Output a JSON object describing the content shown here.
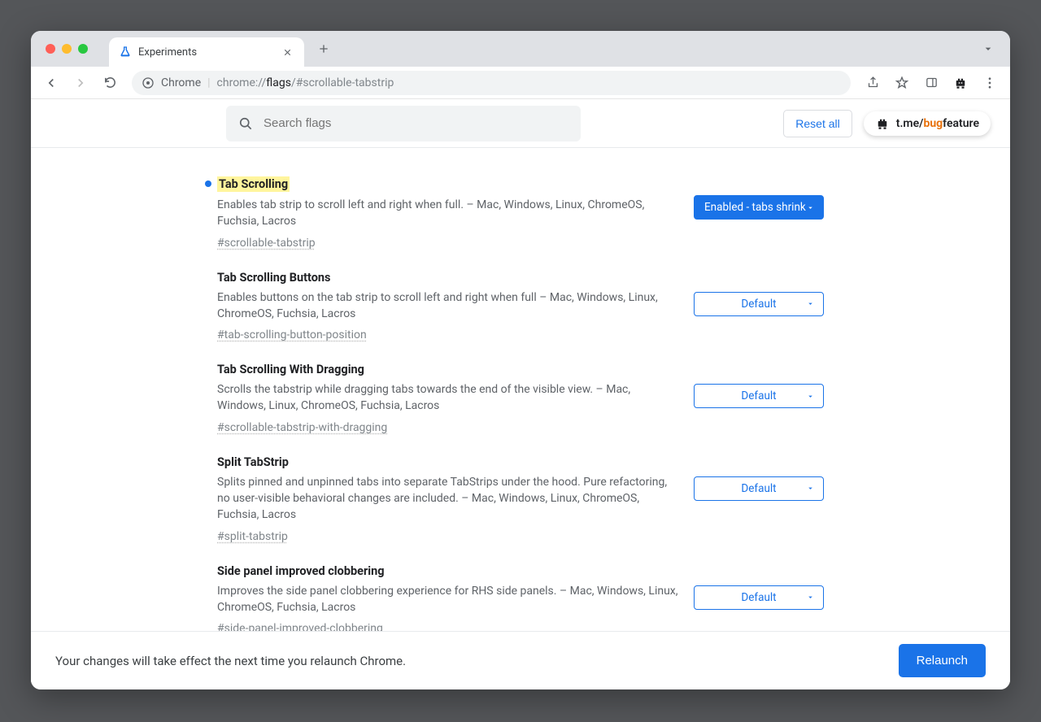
{
  "browser": {
    "tab_title": "Experiments",
    "omnibox_label": "Chrome",
    "url_prefix": "chrome://",
    "url_path": "flags",
    "url_frag": "/#scrollable-tabstrip"
  },
  "header": {
    "search_placeholder": "Search flags",
    "reset_label": "Reset all",
    "badge_prefix": "t.me/",
    "badge_bug": "bug",
    "badge_feature": "feature"
  },
  "flags": [
    {
      "title": "Tab Scrolling",
      "desc": "Enables tab strip to scroll left and right when full. – Mac, Windows, Linux, ChromeOS, Fuchsia, Lacros",
      "hash": "#scrollable-tabstrip",
      "value": "Enabled - tabs shrink",
      "modified": true
    },
    {
      "title": "Tab Scrolling Buttons",
      "desc": "Enables buttons on the tab strip to scroll left and right when full – Mac, Windows, Linux, ChromeOS, Fuchsia, Lacros",
      "hash": "#tab-scrolling-button-position",
      "value": "Default",
      "modified": false
    },
    {
      "title": "Tab Scrolling With Dragging",
      "desc": "Scrolls the tabstrip while dragging tabs towards the end of the visible view. – Mac, Windows, Linux, ChromeOS, Fuchsia, Lacros",
      "hash": "#scrollable-tabstrip-with-dragging",
      "value": "Default",
      "modified": false
    },
    {
      "title": "Split TabStrip",
      "desc": "Splits pinned and unpinned tabs into separate TabStrips under the hood. Pure refactoring, no user-visible behavioral changes are included. – Mac, Windows, Linux, ChromeOS, Fuchsia, Lacros",
      "hash": "#split-tabstrip",
      "value": "Default",
      "modified": false
    },
    {
      "title": "Side panel improved clobbering",
      "desc": "Improves the side panel clobbering experience for RHS side panels. – Mac, Windows, Linux, ChromeOS, Fuchsia, Lacros",
      "hash": "#side-panel-improved-clobbering",
      "value": "Default",
      "modified": false
    }
  ],
  "footer": {
    "message": "Your changes will take effect the next time you relaunch Chrome.",
    "relaunch": "Relaunch"
  }
}
